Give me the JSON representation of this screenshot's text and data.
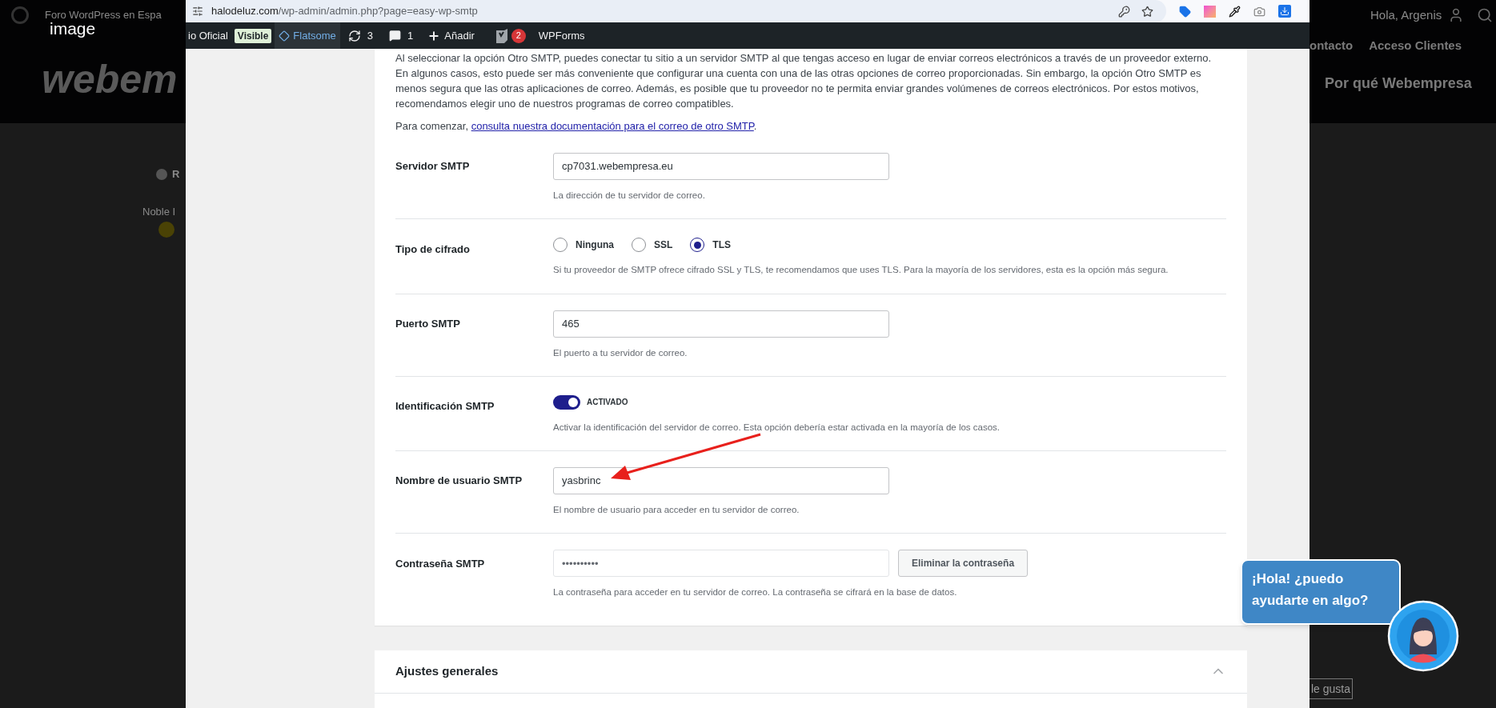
{
  "lightbox": {
    "label": "image"
  },
  "background_page": {
    "site_title": "Foro WordPress en Espa",
    "logo": "webem",
    "greeting": "Hola, Argenis",
    "nav": [
      "ontacto",
      "Acceso Clientes"
    ],
    "nav_secondary": "Por qué Webempresa",
    "author_name": "R",
    "author_rank": "Noble I",
    "like_button": "le gusta"
  },
  "browser": {
    "url_host": "halodeluz.com",
    "url_path": "/wp-admin/admin.php?page=easy-wp-smtp"
  },
  "admin_bar": {
    "site": "io Oficial",
    "visibility_badge": "Visible",
    "theme": "Flatsome",
    "updates": "3",
    "comments": "1",
    "new": "Añadir",
    "seo_badge": "2",
    "forms": "WPForms"
  },
  "intro": {
    "text": "Al seleccionar la opción Otro SMTP, puedes conectar tu sitio a un servidor SMTP al que tengas acceso en lugar de enviar correos electrónicos a través de un proveedor externo. En algunos casos, esto puede ser más conveniente que configurar una cuenta con una de las otras opciones de correo proporcionadas. Sin embargo, la opción Otro SMTP es menos segura que las otras aplicaciones de correo. Además, es posible que tu proveedor no te permita enviar grandes volúmenes de correos electrónicos. Por estos motivos, recomendamos elegir uno de nuestros programas de correo compatibles.",
    "lead": "Para comenzar, ",
    "link": "consulta nuestra documentación para el correo de otro SMTP",
    "trail": "."
  },
  "fields": [
    {
      "kind": "text",
      "label": "Servidor SMTP",
      "value": "cp7031.webempresa.eu",
      "help": "La dirección de tu servidor de correo."
    },
    {
      "kind": "radio",
      "label": "Tipo de cifrado",
      "options": [
        {
          "label": "Ninguna",
          "selected": false
        },
        {
          "label": "SSL",
          "selected": false
        },
        {
          "label": "TLS",
          "selected": true
        }
      ],
      "help": "Si tu proveedor de SMTP ofrece cifrado SSL y TLS, te recomendamos que uses TLS. Para la mayoría de los servidores, esta es la opción más segura."
    },
    {
      "kind": "text",
      "label": "Puerto SMTP",
      "value": "465",
      "help": "El puerto a tu servidor de correo."
    },
    {
      "kind": "toggle",
      "label": "Identificación SMTP",
      "on": true,
      "state_label": "ACTIVADO",
      "help": "Activar la identificación del servidor de correo. Esta opción debería estar activada en la mayoría de los casos."
    },
    {
      "kind": "text",
      "label": "Nombre de usuario SMTP",
      "value": "yasbrinc",
      "help": "El nombre de usuario para acceder en tu servidor de correo."
    },
    {
      "kind": "password",
      "label": "Contraseña SMTP",
      "value": "••••••••••",
      "button": "Eliminar la contraseña",
      "help": "La contraseña para acceder en tu servidor de correo. La contraseña se cifrará en la base de datos."
    }
  ],
  "section": {
    "title": "Ajustes generales",
    "expanded": true
  },
  "chat": {
    "message": "¡Hola! ¿puedo ayudarte en algo?"
  }
}
